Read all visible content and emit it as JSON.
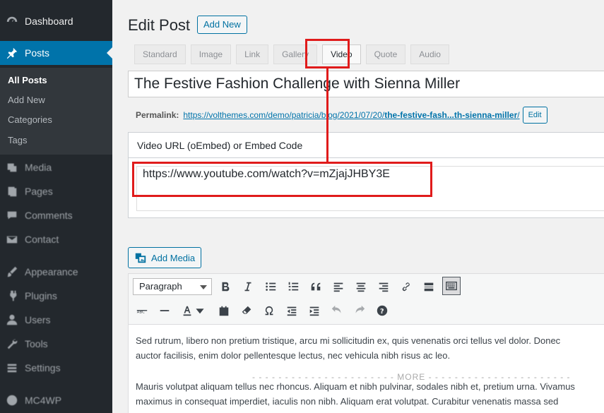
{
  "sidebar": {
    "items": [
      {
        "label": "Dashboard",
        "icon": "dashboard-icon"
      },
      {
        "label": "Posts",
        "icon": "pin-icon"
      },
      {
        "label": "Media",
        "icon": "media-icon"
      },
      {
        "label": "Pages",
        "icon": "pages-icon"
      },
      {
        "label": "Comments",
        "icon": "comments-icon"
      },
      {
        "label": "Contact",
        "icon": "mail-icon"
      },
      {
        "label": "Appearance",
        "icon": "brush-icon"
      },
      {
        "label": "Plugins",
        "icon": "plugin-icon"
      },
      {
        "label": "Users",
        "icon": "users-icon"
      },
      {
        "label": "Tools",
        "icon": "wrench-icon"
      },
      {
        "label": "Settings",
        "icon": "settings-icon"
      },
      {
        "label": "MC4WP",
        "icon": "mc4wp-icon"
      }
    ],
    "submenu": [
      "All Posts",
      "Add New",
      "Categories",
      "Tags"
    ]
  },
  "header": {
    "title": "Edit Post",
    "add_new": "Add New"
  },
  "formats": [
    "Standard",
    "Image",
    "Link",
    "Gallery",
    "Video",
    "Quote",
    "Audio"
  ],
  "post": {
    "title": "The Festive Fashion Challenge with Sienna Miller",
    "permalink_label": "Permalink:",
    "permalink_base": "https://volthemes.com/demo/patricia/blog/2021/07/20/",
    "permalink_slug": "the-festive-fash...th-sienna-miller",
    "permalink_suffix": "/",
    "edit_label": "Edit"
  },
  "video_box": {
    "heading": "Video URL (oEmbed) or Embed Code",
    "url": "https://www.youtube.com/watch?v=mZjajJHBY3E"
  },
  "editor": {
    "add_media": "Add Media",
    "format_select": "Paragraph",
    "content": [
      "Sed rutrum, libero non pretium tristique, arcu mi sollicitudin ex, quis venenatis orci tellus vel dolor. Donec",
      "auctor facilisis, enim dolor pellentesque lectus, nec vehicula nibh risus ac leo.",
      "Mauris volutpat aliquam tellus nec rhoncus. Aliquam et nibh pulvinar, sodales nibh et, pretium urna. Vivamus",
      "maximus in consequat imperdiet, iaculis non nibh. Aliquam erat volutpat. Curabitur venenatis massa sed"
    ],
    "more_label": "MORE"
  },
  "colors": {
    "accent": "#0073aa",
    "highlight": "#e01b1b",
    "sidebar": "#23282d"
  }
}
